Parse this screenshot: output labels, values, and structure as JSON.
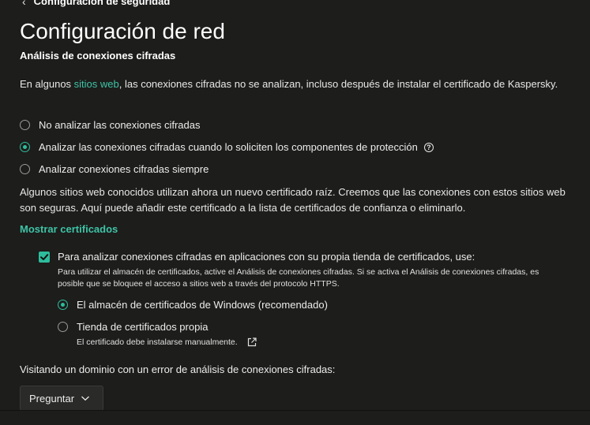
{
  "header": {
    "back_label": "Configuración de seguridad",
    "title": "Configuración de red"
  },
  "section": {
    "title": "Análisis de conexiones cifradas",
    "intro_before": "En algunos ",
    "intro_link": "sitios web",
    "intro_after": ", las conexiones cifradas no se analizan, incluso después de instalar el certificado de Kaspersky."
  },
  "scan_options": [
    {
      "label": "No analizar las conexiones cifradas",
      "selected": false
    },
    {
      "label": "Analizar las conexiones cifradas cuando lo soliciten los componentes de protección",
      "selected": true
    },
    {
      "label": "Analizar conexiones cifradas siempre",
      "selected": false
    }
  ],
  "root_cert_text": "Algunos sitios web conocidos utilizan ahora un nuevo certificado raíz. Creemos que las conexiones con estos sitios web son seguras. Aquí puede añadir este certificado a la lista de certificados de confianza o eliminarlo.",
  "show_certificates_label": "Mostrar certificados",
  "own_store": {
    "checked": true,
    "label": "Para analizar conexiones cifradas en aplicaciones con su propia tienda de certificados, use:",
    "description": "Para utilizar el almacén de certificados, active el Análisis de conexiones cifradas. Si se activa el Análisis de conexiones cifradas, es posible que se bloquee el acceso a sitios web a través del protocolo HTTPS.",
    "options": [
      {
        "label": "El almacén de certificados de Windows (recomendado)",
        "selected": true
      },
      {
        "label": "Tienda de certificados propia",
        "selected": false
      }
    ],
    "manual_note": "El certificado debe instalarse manualmente."
  },
  "domain_error": {
    "label": "Visitando un dominio con un error de análisis de conexiones cifradas:",
    "selected_value": "Preguntar"
  },
  "colors": {
    "background": "#1d1d1b",
    "accent": "#2dbd9c",
    "link": "#3ec3a6"
  },
  "icons": {
    "back": "chevron-left-icon",
    "help": "question-circle-icon",
    "external": "external-link-icon",
    "dropdown": "chevron-down-icon",
    "check": "check-icon"
  }
}
